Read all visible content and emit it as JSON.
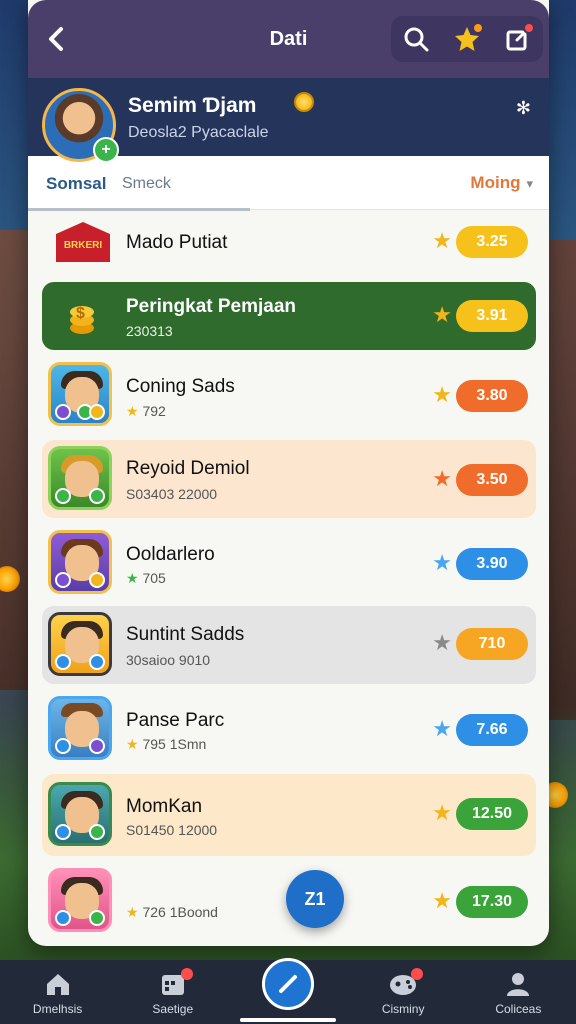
{
  "topbar": {
    "title": "Dati",
    "back_icon": "chevron-left-icon",
    "icons": [
      "search-icon",
      "star-notification-icon",
      "compose-icon"
    ]
  },
  "profile": {
    "name": "Semim Ɗjam",
    "subtitle": "Deosla2 Pyacaclale"
  },
  "tabs": {
    "active": "Somsal",
    "inactive": "Smeck",
    "sort_label": "Moing"
  },
  "rows": [
    {
      "name": "Mado Putiat",
      "sub": "",
      "score": "3.25",
      "pill_color": "#f6c11b",
      "star_color": "#f2b51a",
      "bg": "#ffffff",
      "thumb": "logo",
      "thumb_text": "BRKERI"
    },
    {
      "name": "Peringkat Pemjaan",
      "sub": "230313",
      "score": "3.91",
      "pill_color": "#f6c11b",
      "star_color": "#f2b51a",
      "bg": "#2e6b2c",
      "thumb": "coin",
      "thumb_text": ""
    },
    {
      "name": "Coning Sads",
      "sub": "792",
      "score": "3.80",
      "pill_color": "#ef6c2a",
      "star_color": "#f2b51a",
      "bg": "#ffffff",
      "thumb": "hero",
      "thumb_text": ""
    },
    {
      "name": "Reyoid Demiol",
      "sub": "S03403 22000",
      "score": "3.50",
      "pill_color": "#ef6c2a",
      "star_color": "#ef6c2a",
      "bg": "#fde6cf",
      "thumb": "hero-gold",
      "thumb_text": ""
    },
    {
      "name": "Ooldarlero",
      "sub": "705",
      "score": "3.90",
      "pill_color": "#2e8fe6",
      "star_color": "#4ba6f0",
      "bg": "#ffffff",
      "thumb": "hero-purple",
      "thumb_text": ""
    },
    {
      "name": "Suntint Sadds",
      "sub": "30saioo 9010",
      "score": "710",
      "pill_color": "#f6a623",
      "star_color": "#8a8a8a",
      "bg": "#e4e4e4",
      "thumb": "hero-yellow",
      "thumb_text": ""
    },
    {
      "name": "Panse Parc",
      "sub": "795 1Smn",
      "score": "7.66",
      "pill_color": "#2e8fe6",
      "star_color": "#4ba6f0",
      "bg": "#ffffff",
      "thumb": "hero-cowboy",
      "thumb_text": ""
    },
    {
      "name": "MomKan",
      "sub": "S01450 12000",
      "score": "12.50",
      "pill_color": "#3aa43a",
      "star_color": "#f2b51a",
      "bg": "#fde9c9",
      "thumb": "hero-green",
      "thumb_text": ""
    },
    {
      "name": "",
      "sub": "726 1Boond",
      "score": "17.30",
      "pill_color": "#3aa43a",
      "star_color": "#f2b51a",
      "bg": "#ffffff",
      "thumb": "hero-pink",
      "thumb_text": ""
    }
  ],
  "fab_label": "Z1",
  "bottomnav": [
    {
      "label": "Dmelhsis",
      "icon": "home-icon"
    },
    {
      "label": "Saetige",
      "icon": "calendar-icon"
    },
    {
      "label": "",
      "icon": "pencil-icon"
    },
    {
      "label": "Cisminy",
      "icon": "gamepad-icon"
    },
    {
      "label": "Coliceas",
      "icon": "profile-icon"
    }
  ]
}
